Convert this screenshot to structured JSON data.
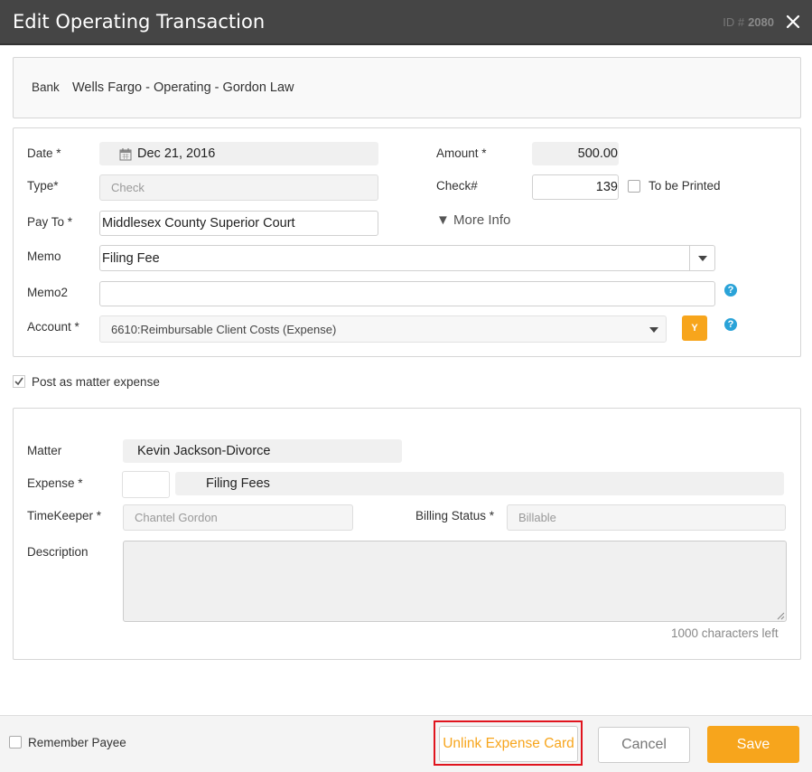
{
  "dialog": {
    "title": "Edit Operating Transaction",
    "id_label": "ID #",
    "id_value": "2080"
  },
  "bank": {
    "label": "Bank",
    "value": "Wells Fargo - Operating - Gordon Law"
  },
  "transaction": {
    "date_label": "Date *",
    "date_value": "Dec 21, 2016",
    "amount_label": "Amount *",
    "amount_value": "500.00",
    "type_label": "Type*",
    "type_placeholder": "Check",
    "check_label": "Check#",
    "check_value": "139",
    "to_be_printed_label": "To be Printed",
    "to_be_printed_checked": false,
    "pay_to_label": "Pay To *",
    "pay_to_value": "Middlesex County Superior Court",
    "more_info_label": "▼ More Info",
    "memo_label": "Memo",
    "memo_value": "Filing Fee",
    "memo2_label": "Memo2",
    "memo2_value": "",
    "account_label": "Account *",
    "account_value": "6610:Reimbursable Client Costs (Expense)",
    "account_badge": "Y",
    "help_glyph": "?"
  },
  "post_matter_expense": {
    "label": "Post as matter expense",
    "checked": true
  },
  "matter_expense": {
    "matter_label": "Matter",
    "matter_value": "Kevin Jackson-Divorce",
    "expense_label": "Expense *",
    "expense_code": "",
    "expense_value": "Filing Fees",
    "timekeeper_label": "TimeKeeper *",
    "timekeeper_placeholder": "Chantel Gordon",
    "billing_status_label": "Billing Status *",
    "billing_status_placeholder": "Billable",
    "description_label": "Description",
    "description_value": "",
    "chars_left": "1000 characters left"
  },
  "footer": {
    "remember_payee_label": "Remember Payee",
    "remember_payee_checked": false,
    "unlink_label": "Unlink Expense Card",
    "cancel_label": "Cancel",
    "save_label": "Save"
  },
  "colors": {
    "header_bg": "#454545",
    "accent_orange": "#f7a51c",
    "help_blue": "#2aa3d8",
    "highlight_red": "#e0141e"
  },
  "icons": {
    "close": "close-icon",
    "calendar": "calendar-icon",
    "dropdown": "chevron-down-icon",
    "help": "help-icon",
    "checkmark": "checkmark-icon",
    "resize": "resize-grip-icon"
  }
}
